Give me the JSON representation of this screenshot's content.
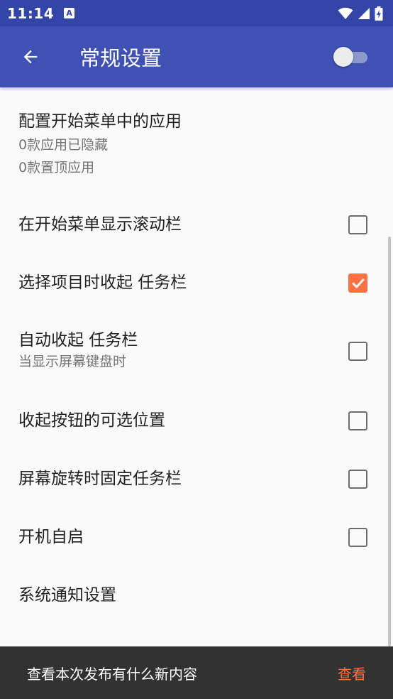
{
  "status_bar": {
    "time": "11:14",
    "notification_glyph": "A"
  },
  "app_bar": {
    "title": "常规设置",
    "master_switch_on": false
  },
  "settings": [
    {
      "title": "配置开始菜单中的应用",
      "summary_lines": [
        "0款应用已隐藏",
        "0款置顶应用"
      ]
    },
    {
      "title": "在开始菜单显示滚动栏",
      "checked": false
    },
    {
      "title": "选择项目时收起 任务栏",
      "checked": true
    },
    {
      "title": "自动收起 任务栏",
      "summary": "当显示屏幕键盘时",
      "checked": false
    },
    {
      "title": "收起按钮的可选位置",
      "checked": false
    },
    {
      "title": "屏幕旋转时固定任务栏",
      "checked": false
    },
    {
      "title": "开机自启",
      "checked": false
    },
    {
      "title": "系统通知设置"
    }
  ],
  "snackbar": {
    "message": "查看本次发布有什么新内容",
    "action": "查看"
  },
  "colors": {
    "app_bar": "#3f51b5",
    "status_bar": "#3346a8",
    "accent": "#ff7043",
    "snackbar": "#323232"
  }
}
